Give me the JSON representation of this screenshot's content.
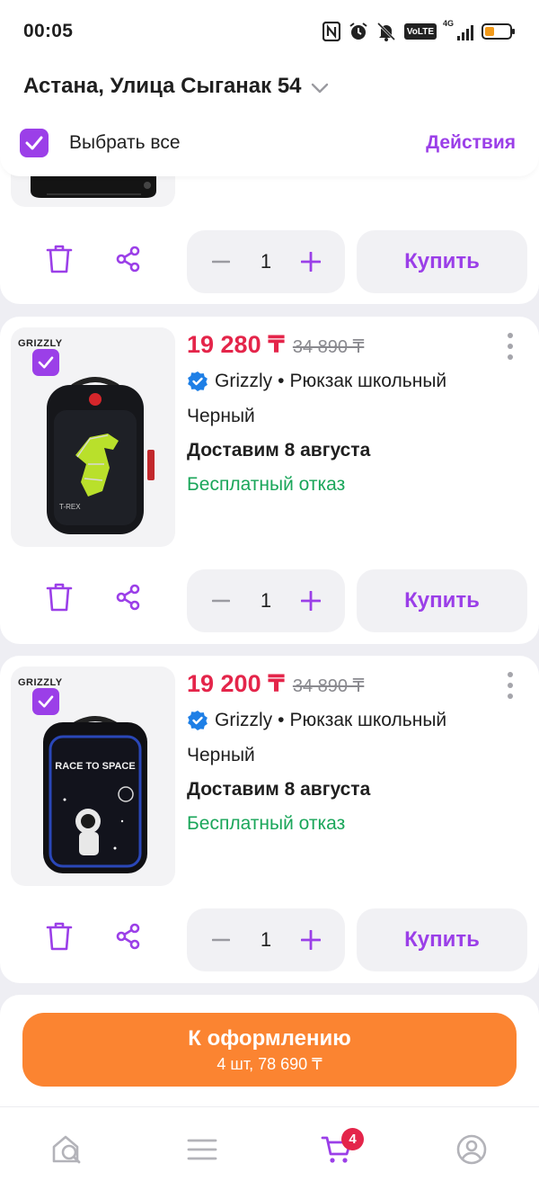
{
  "status_bar": {
    "time": "00:05",
    "icons": [
      "nfc-icon",
      "alarm-icon",
      "bell-muted-icon",
      "volte-icon",
      "signal-icon",
      "battery-icon"
    ],
    "volte_label": "VoLTE",
    "network_label": "4G"
  },
  "location": {
    "address": "Астана, Улица Сыганак 54"
  },
  "select_bar": {
    "label": "Выбрать все",
    "actions": "Действия",
    "checked": true
  },
  "colors": {
    "accent": "#9b3fe8",
    "price": "#e4254a",
    "free_refund": "#1aa65a",
    "checkout": "#fb8431"
  },
  "items": [
    {
      "quantity": "1",
      "buy_label": "Купить"
    },
    {
      "price": "19 280 ₸",
      "old_price": "34 890 ₸",
      "brand": "Grizzly",
      "separator": "•",
      "name": "Рюкзак школьный",
      "color": "Черный",
      "delivery": "Доставим 8 августа",
      "refund": "Бесплатный отказ",
      "quantity": "1",
      "buy_label": "Купить",
      "image_brand": "GRIZZLY",
      "image_motif": "T-REX"
    },
    {
      "price": "19 200 ₸",
      "old_price": "34 890 ₸",
      "brand": "Grizzly",
      "separator": "•",
      "name": "Рюкзак школьный",
      "color": "Черный",
      "delivery": "Доставим 8 августа",
      "refund": "Бесплатный отказ",
      "quantity": "1",
      "buy_label": "Купить",
      "image_brand": "GRIZZLY",
      "image_motif": "RACE TO SPACE"
    }
  ],
  "checkout": {
    "title": "К оформлению",
    "summary": "4 шт, 78 690 ₸"
  },
  "tab_bar": {
    "tabs": [
      "home-search-icon",
      "catalog-icon",
      "cart-icon",
      "profile-icon"
    ],
    "cart_badge": "4"
  }
}
